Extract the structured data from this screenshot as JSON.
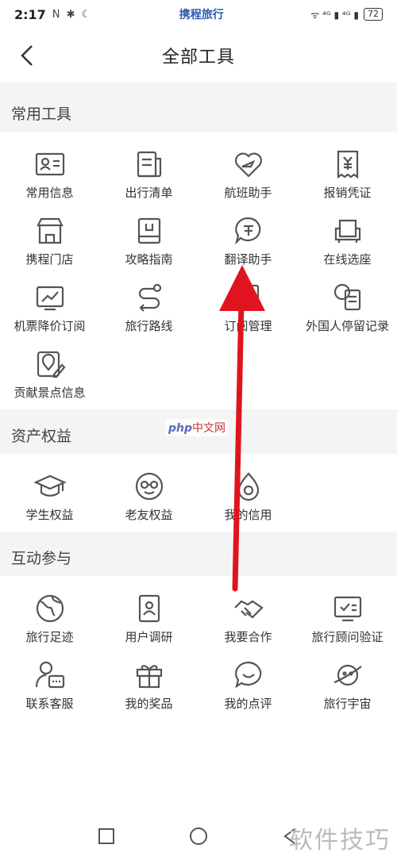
{
  "status": {
    "time": "2:17",
    "glyphs": "N ✱ ☾",
    "brand": "携程旅行",
    "signal": "ᯤ ⁴ᴳ ▮ ⁴ᴳ ▮",
    "battery": "72"
  },
  "header": {
    "title": "全部工具"
  },
  "sections": [
    {
      "title": "常用工具",
      "tools": [
        {
          "label": "常用信息",
          "icon": "id-card-icon"
        },
        {
          "label": "出行清单",
          "icon": "checklist-icon"
        },
        {
          "label": "航班助手",
          "icon": "flight-heart-icon"
        },
        {
          "label": "报销凭证",
          "icon": "receipt-icon"
        },
        {
          "label": "携程门店",
          "icon": "store-icon"
        },
        {
          "label": "攻略指南",
          "icon": "guide-book-icon"
        },
        {
          "label": "翻译助手",
          "icon": "translate-icon"
        },
        {
          "label": "在线选座",
          "icon": "seat-icon"
        },
        {
          "label": "机票降价订阅",
          "icon": "price-chart-icon"
        },
        {
          "label": "旅行路线",
          "icon": "route-icon"
        },
        {
          "label": "订阅管理",
          "icon": "subscription-icon"
        },
        {
          "label": "外国人停留记录",
          "icon": "foreigner-record-icon"
        },
        {
          "label": "贡献景点信息",
          "icon": "map-pin-edit-icon"
        }
      ]
    },
    {
      "title": "资产权益",
      "tools": [
        {
          "label": "学生权益",
          "icon": "graduation-cap-icon"
        },
        {
          "label": "老友权益",
          "icon": "old-friend-icon"
        },
        {
          "label": "我的信用",
          "icon": "credit-icon"
        }
      ]
    },
    {
      "title": "互动参与",
      "tools": [
        {
          "label": "旅行足迹",
          "icon": "globe-icon"
        },
        {
          "label": "用户调研",
          "icon": "survey-icon"
        },
        {
          "label": "我要合作",
          "icon": "handshake-icon"
        },
        {
          "label": "旅行顾问验证",
          "icon": "advisor-verify-icon"
        },
        {
          "label": "联系客服",
          "icon": "customer-service-icon"
        },
        {
          "label": "我的奖品",
          "icon": "gift-icon"
        },
        {
          "label": "我的点评",
          "icon": "comment-icon"
        },
        {
          "label": "旅行宇宙",
          "icon": "planet-icon"
        }
      ]
    }
  ],
  "watermarks": {
    "mid_brand": "php",
    "mid_text": "中文网",
    "corner": "软件技巧"
  }
}
